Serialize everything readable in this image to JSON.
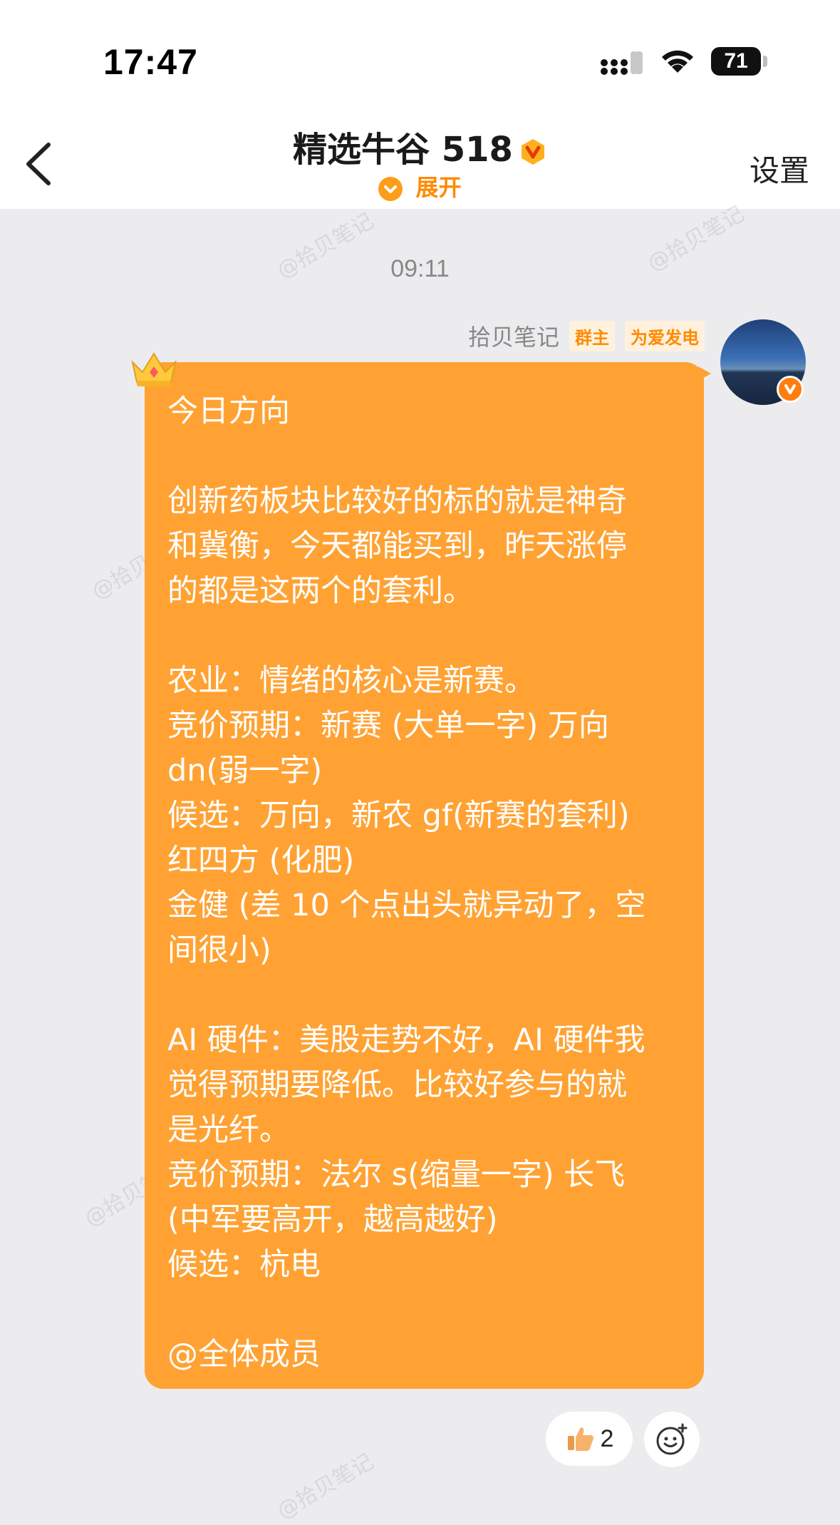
{
  "status_bar": {
    "time": "17:47",
    "battery_level": "71",
    "icons": [
      "signal-icon",
      "wifi-icon",
      "battery-icon"
    ]
  },
  "header": {
    "title": "精选牛谷 518",
    "expand_label": "展开",
    "settings_label": "设置",
    "back_icon": "chevron-left-icon",
    "verified_icon": "verified-v-badge-icon",
    "accent_color": "#ff8a00"
  },
  "chat": {
    "timestamp": "09:11",
    "watermark": "@拾贝笔记",
    "message": {
      "sender": "拾贝笔记",
      "tags": [
        "群主",
        "为爱发电"
      ],
      "bubble_color": "#ffa233",
      "lines": [
        "今日方向",
        "",
        "创新药板块比较好的标的就是神奇",
        "和冀衡，今天都能买到，昨天涨停",
        "的都是这两个的套利。",
        "",
        "农业：情绪的核心是新赛。",
        "竞价预期：新赛 (大单一字) 万向",
        " dn(弱一字)",
        "候选：万向，新农 gf(新赛的套利)",
        "红四方 (化肥)",
        "金健 (差 10 个点出头就异动了，空",
        "间很小)",
        "",
        "AI 硬件：美股走势不好，AI 硬件我",
        "觉得预期要降低。比较好参与的就",
        "是光纤。",
        "竞价预期：法尔 s(缩量一字) 长飞",
        " (中军要高开，越高越好)",
        "候选：杭电",
        "",
        "@全体成员"
      ]
    },
    "reactions": [
      {
        "icon": "thumbs-up-icon",
        "count": "2"
      }
    ],
    "add_reaction_icon": "add-emoji-icon"
  }
}
